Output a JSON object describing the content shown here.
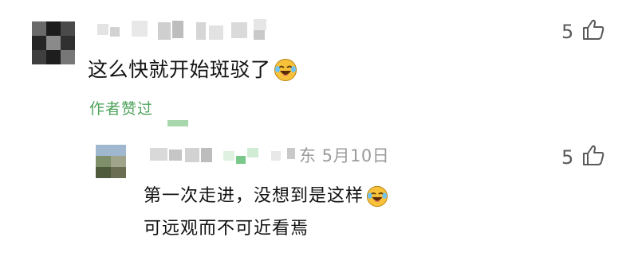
{
  "comment": {
    "text": "这么快就开始斑驳了",
    "emoji": "laughing-crying-emoji",
    "author_liked": "作者赞过",
    "like_count": "5"
  },
  "reply": {
    "meta": "东 5月10日",
    "lines": [
      "第一次走进，没想到是这样",
      "可远观而不可近看焉"
    ],
    "emoji": "laughing-crying-emoji",
    "like_count": "5"
  },
  "colors": {
    "liked_green": "#4ea35b",
    "meta_gray": "#9a9a9a",
    "text": "#111111"
  }
}
